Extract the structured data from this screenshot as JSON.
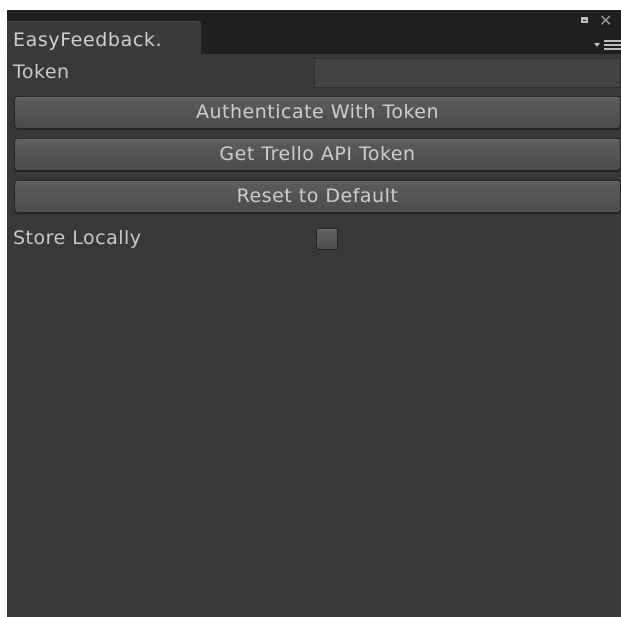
{
  "window": {
    "tab_label": "EasyFeedback.",
    "maximize_icon": "maximize-icon",
    "close_icon": "close-icon",
    "close_glyph": "✕",
    "menu_icon": "context-menu-icon"
  },
  "form": {
    "token_label": "Token",
    "token_value": "",
    "authenticate_label": "Authenticate With Token",
    "get_token_label": "Get Trello API Token",
    "reset_label": "Reset to Default",
    "store_locally_label": "Store Locally",
    "store_locally_checked": false
  },
  "colors": {
    "panel_background": "#383838",
    "tab_bar_background": "#1f1f1f",
    "text": "#c8c8c8"
  }
}
